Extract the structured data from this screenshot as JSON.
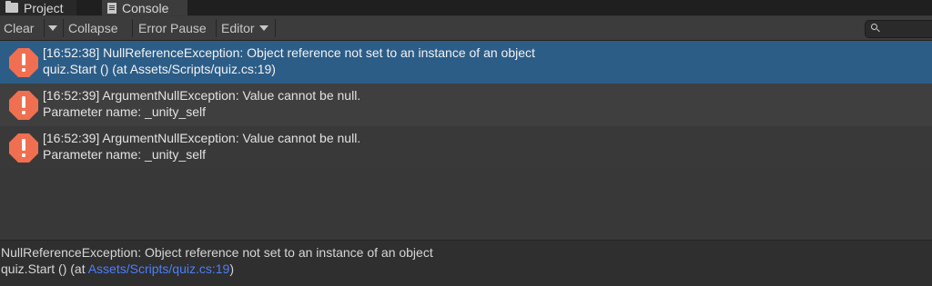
{
  "tabs": [
    {
      "label": "Project",
      "icon": "folder-icon"
    },
    {
      "label": "Console",
      "icon": "console-icon"
    }
  ],
  "toolbar": {
    "clear_label": "Clear",
    "collapse_label": "Collapse",
    "error_pause_label": "Error Pause",
    "editor_label": "Editor"
  },
  "logs": [
    {
      "line1": "[16:52:38] NullReferenceException: Object reference not set to an instance of an object",
      "line2": "quiz.Start () (at Assets/Scripts/quiz.cs:19)",
      "selected": true
    },
    {
      "line1": "[16:52:39] ArgumentNullException: Value cannot be null.",
      "line2": "Parameter name: _unity_self",
      "selected": false
    },
    {
      "line1": "[16:52:39] ArgumentNullException: Value cannot be null.",
      "line2": "Parameter name: _unity_self",
      "selected": false
    }
  ],
  "details": {
    "line1": "NullReferenceException: Object reference not set to an instance of an object",
    "line2_prefix": "quiz.Start () (at ",
    "line2_link": "Assets/Scripts/quiz.cs:19",
    "line2_suffix": ")"
  },
  "colors": {
    "selected_row": "#2c5d87",
    "error_icon": "#f06f50",
    "link": "#4c7eff",
    "background": "#383838"
  }
}
